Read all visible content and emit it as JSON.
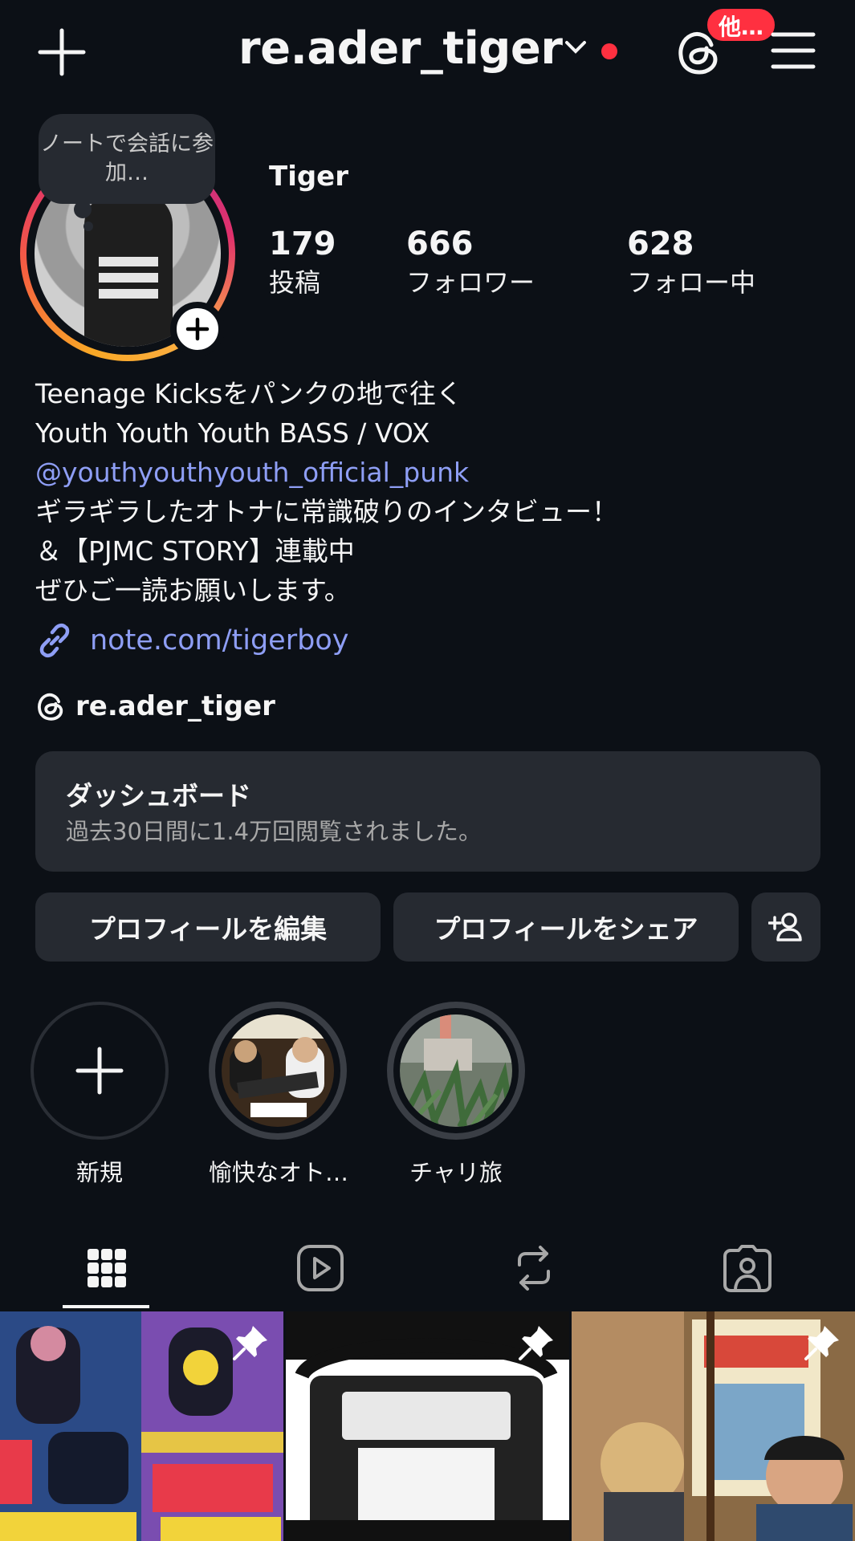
{
  "topbar": {
    "username": "re.ader_tiger",
    "notif_badge": "他…"
  },
  "profile": {
    "note": "ノートで会話に参加…",
    "display_name": "Tiger",
    "stats": [
      {
        "value": "179",
        "label": "投稿"
      },
      {
        "value": "666",
        "label": "フォロワー"
      },
      {
        "value": "628",
        "label": "フォロー中"
      }
    ]
  },
  "bio": {
    "line1": "Teenage Kicksをパンクの地で往く",
    "line2": "Youth Youth Youth BASS / VOX",
    "mention": "@youthyouthyouth_official_punk",
    "line4": "ギラギラしたオトナに常識破りのインタビュー！",
    "line5": "＆【PJMC STORY】連載中",
    "line6": "ぜひご一読お願いします。",
    "link": "note.com/tigerboy",
    "threads_handle": "re.ader_tiger"
  },
  "dashboard": {
    "title": "ダッシュボード",
    "subtitle": "過去30日間に1.4万回閲覧されました。"
  },
  "buttons": {
    "edit": "プロフィールを編集",
    "share": "プロフィールをシェア"
  },
  "highlights": [
    {
      "label": "新規"
    },
    {
      "label": "愉快なオト…"
    },
    {
      "label": "チャリ旅"
    }
  ],
  "colors": {
    "background": "#0c1016",
    "surface": "#262a31",
    "link": "#8e9ef5",
    "badge": "#ff3040"
  }
}
